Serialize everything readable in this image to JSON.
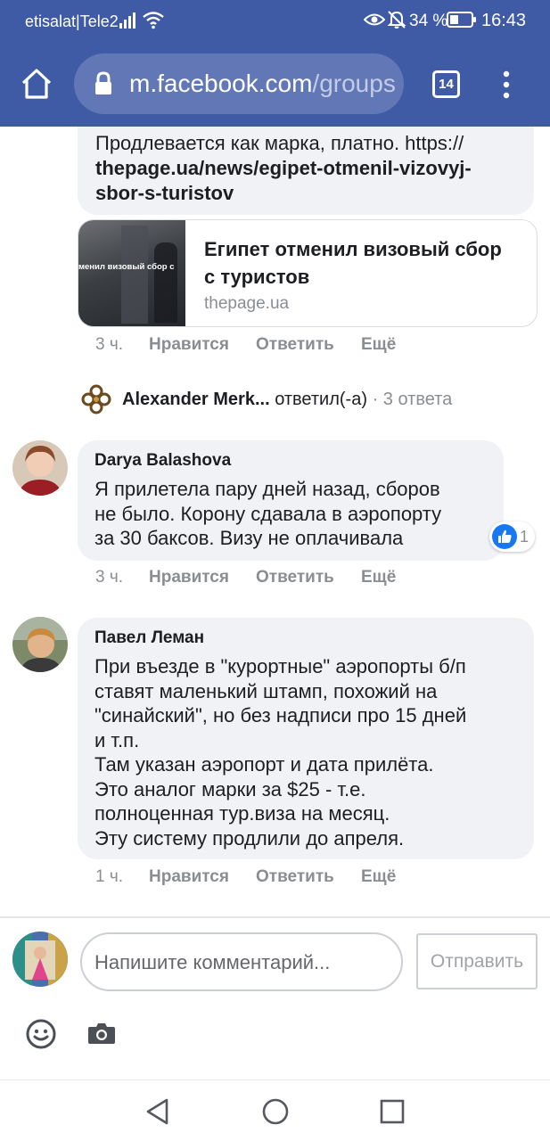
{
  "status_bar": {
    "carrier": "etisalat|Tele2",
    "battery": "34 %",
    "time": "16:43"
  },
  "browser": {
    "url_host": "m.facebook.com",
    "url_path": "/groups",
    "tab_count": "14"
  },
  "comments": [
    {
      "text_lines": [
        "Продлевается как марка, платно. https://",
        "thepage.ua/news/egipet-otmenil-vizovyj-",
        "sbor-s-turistov"
      ],
      "link_card": {
        "thumb_text": "менил визовый сбор с",
        "title_lines": [
          "Египет отменил визовый сбор",
          "с туристов"
        ],
        "domain": "thepage.ua"
      },
      "time": "3 ч.",
      "like": "Нравится",
      "reply": "Ответить",
      "more": "Ещё"
    },
    {
      "author": "Darya Balashova",
      "text_lines": [
        "Я прилетела пару дней назад, сборов",
        "не было. Корону сдавала в аэропорту",
        "за 30 баксов. Визу не оплачивала"
      ],
      "reaction_count": "1",
      "time": "3 ч.",
      "like": "Нравится",
      "reply": "Ответить",
      "more": "Ещё"
    },
    {
      "author": "Павел Леман",
      "text_lines": [
        "При въезде в \"курортные\" аэропорты б/п",
        "ставят маленький штамп, похожий на",
        "\"синайский\", но без надписи про 15 дней",
        "и т.п.",
        "Там указан аэропорт и дата прилёта.",
        "Это аналог марки за $25 - т.е.",
        "полноценная тур.виза на месяц.",
        "Эту систему продлили до апреля."
      ],
      "time": "1 ч.",
      "like": "Нравится",
      "reply": "Ответить",
      "more": "Ещё"
    }
  ],
  "reply_summary": {
    "author": "Alexander Merk...",
    "action": "ответил(-а)",
    "separator": "·",
    "count": "3 ответа"
  },
  "composer": {
    "placeholder": "Напишите комментарий...",
    "send_label": "Отправить"
  },
  "colors": {
    "header_blue": "#3f5ba5",
    "like_blue": "#1877f2",
    "bubble_gray": "#f0f2f5",
    "meta_gray": "#8a8d91"
  },
  "icons": [
    "home-icon",
    "lock-icon",
    "tabs-icon",
    "menu-dots-icon",
    "signal-icon",
    "wifi-icon",
    "eye-icon",
    "bell-off-icon",
    "battery-icon",
    "like-icon",
    "emoji-icon",
    "camera-icon",
    "back-icon",
    "home-nav-icon",
    "recents-icon"
  ]
}
